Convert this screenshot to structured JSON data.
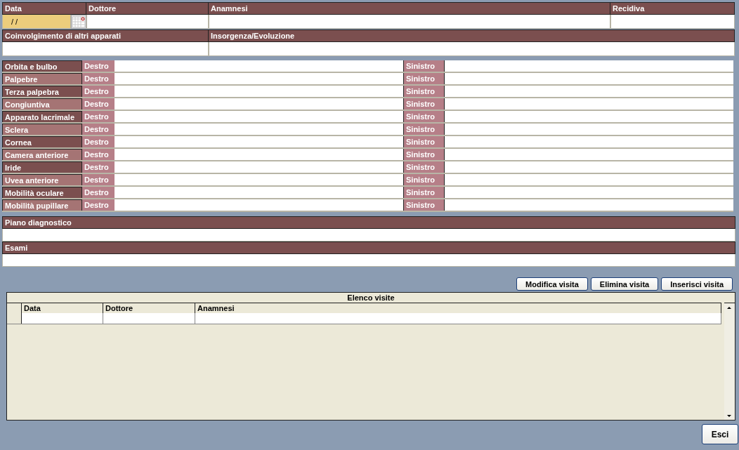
{
  "visit_header": {
    "columns": [
      {
        "label": "Data",
        "kind": "date",
        "value": "/ /"
      },
      {
        "label": "Dottore",
        "kind": "text"
      },
      {
        "label": "Anamnesi",
        "kind": "text"
      },
      {
        "label": "Recidiva",
        "kind": "text"
      }
    ]
  },
  "details": [
    {
      "label": "Coinvolgimento di altri apparati"
    },
    {
      "label": "Insorgenza/Evoluzione"
    }
  ],
  "exam_rows": [
    {
      "label": "Orbita e bulbo",
      "right": "Destro",
      "left": "Sinistro"
    },
    {
      "label": "Palpebre",
      "right": "Destro",
      "left": "Sinistro"
    },
    {
      "label": "Terza palpebra",
      "right": "Destro",
      "left": "Sinistro"
    },
    {
      "label": "Congiuntiva",
      "right": "Destro",
      "left": "Sinistro"
    },
    {
      "label": "Apparato lacrimale",
      "right": "Destro",
      "left": "Sinistro"
    },
    {
      "label": "Sclera",
      "right": "Destro",
      "left": "Sinistro"
    },
    {
      "label": "Cornea",
      "right": "Destro",
      "left": "Sinistro"
    },
    {
      "label": "Camera anteriore",
      "right": "Destro",
      "left": "Sinistro"
    },
    {
      "label": "Iride",
      "right": "Destro",
      "left": "Sinistro"
    },
    {
      "label": "Uvea anteriore",
      "right": "Destro",
      "left": "Sinistro"
    },
    {
      "label": "Mobilità oculare",
      "right": "Destro",
      "left": "Sinistro"
    },
    {
      "label": "Mobilità pupillare",
      "right": "Destro",
      "left": "Sinistro"
    }
  ],
  "sections": [
    {
      "label": "Piano diagnostico"
    },
    {
      "label": "Esami"
    }
  ],
  "actions": [
    "Modifica visita",
    "Elimina visita",
    "Inserisci visita"
  ],
  "visits_list": {
    "title": "Elenco visite",
    "columns": [
      "Data",
      "Dottore",
      "Anamnesi"
    ]
  },
  "exit_button": "Esci"
}
